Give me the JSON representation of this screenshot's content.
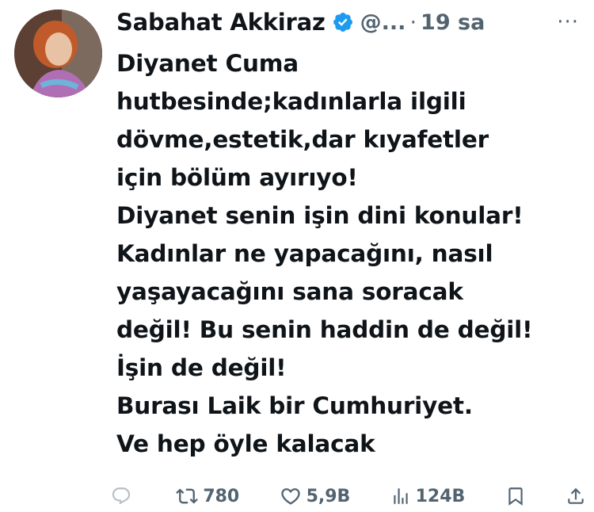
{
  "author": {
    "name": "Sabahat Akkiraz",
    "handle": "@...",
    "separator": "·",
    "time": "19 sa",
    "more_label": "···"
  },
  "tweet": {
    "lines": [
      "Diyanet Cuma",
      "hutbesinde;kadınlarla ilgili",
      "dövme,estetik,dar kıyafetler",
      "için bölüm ayırıyo!",
      "Diyanet senin işin dini konular!",
      "Kadınlar ne yapacağını, nasıl",
      "yaşayacağını sana soracak",
      "değil! Bu senin haddin de değil!",
      "İşin de değil!",
      "Burası Laik bir Cumhuriyet.",
      "Ve hep öyle kalacak"
    ]
  },
  "actions": {
    "reply_count": "",
    "retweet_count": "780",
    "like_count": "5,9B",
    "view_count": "124B"
  },
  "colors": {
    "text": "#0f1419",
    "muted": "#536471",
    "verified": "#1d9bf0"
  }
}
